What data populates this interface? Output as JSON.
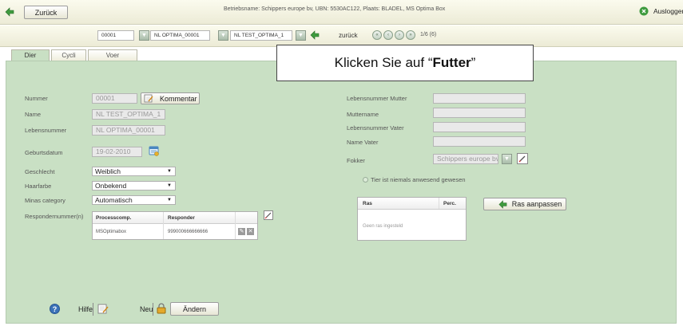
{
  "topbar": {
    "back_label": "Zurück",
    "info": "Betriebsname: Schippers europe bv, UBN: 5530AC122, Plaats: BLADEL, MS Optima Box",
    "logout_label": "Ausloggen"
  },
  "navbar": {
    "number": "00001",
    "name_select": "NL OPTIMA_00001",
    "name2_select": "NL TEST_OPTIMA_1",
    "back_label": "zurück",
    "counter": "1/6 (6)"
  },
  "tabs": [
    {
      "label": "Dier"
    },
    {
      "label": "Cycli"
    },
    {
      "label": "Voer"
    }
  ],
  "callout": {
    "prefix": "Klicken Sie auf “",
    "bold": "Futter",
    "suffix": "”"
  },
  "left": {
    "nummer_label": "Nummer",
    "nummer_value": "00001",
    "kommentar_label": "Kommentar",
    "name_label": "Name",
    "name_value": "NL TEST_OPTIMA_1",
    "lebensnummer_label": "Lebensnummer",
    "lebensnummer_value": "NL OPTIMA_00001",
    "geburtsdatum_label": "Geburtsdatum",
    "geburtsdatum_value": "19-02-2010",
    "geschlecht_label": "Geschlecht",
    "geschlecht_value": "Weiblich",
    "haarfarbe_label": "Haarfarbe",
    "haarfarbe_value": "Onbekend",
    "minas_label": "Minas category",
    "minas_value": "Automatisch",
    "respond_label": "Respondernummer(n)",
    "respond_table": {
      "headers": [
        "Processcomp.",
        "Responder"
      ],
      "rows": [
        [
          "MSOptimabox",
          "999000666666666"
        ]
      ]
    }
  },
  "right": {
    "leb_mutter_label": "Lebensnummer Mutter",
    "muttername_label": "Muttername",
    "leb_vater_label": "Lebensnummer Vater",
    "name_vater_label": "Name Vater",
    "fokker_label": "Fokker",
    "fokker_value": "Schippers europe bv",
    "nie_anwesend_label": "Tier ist niemals anwesend gewesen",
    "ras_table": {
      "headers": [
        "Ras",
        "Perc."
      ],
      "empty": "Geen ras ingesteld"
    },
    "ras_button": "Ras aanpassen"
  },
  "bottom": {
    "hilfe": "Hilfe",
    "neu": "Neu",
    "andern": "Ändern"
  },
  "colors": {
    "panel": "#c9e0c4",
    "topbar": "#f4f3e2",
    "icon_green": "#3e9b3e"
  }
}
